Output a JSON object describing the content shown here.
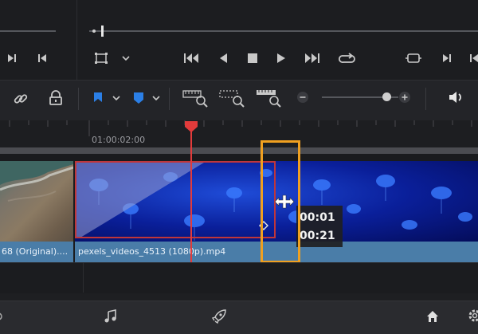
{
  "timeline": {
    "timecode": "01:00:02:00"
  },
  "clips": [
    {
      "label": "68 (Original)...."
    },
    {
      "label": "pexels_videos_4513 (1080p).mp4"
    }
  ],
  "tooltip": {
    "line1": "00:01",
    "line2": "00:21"
  },
  "icons": {
    "transport": [
      "next-frame-icon",
      "prev-frame-icon",
      "crop-icon",
      "chevron-down-icon",
      "skip-to-start-icon",
      "play-reverse-icon",
      "stop-icon",
      "play-icon",
      "skip-to-end-icon",
      "loop-icon",
      "match-frame-icon",
      "next-frame-icon",
      "prev-frame-icon"
    ],
    "toolbar": [
      "link-icon",
      "lock-icon",
      "flag-icon",
      "marker-icon",
      "zoom-full-icon",
      "zoom-detail-icon",
      "zoom-custom-icon",
      "zoom-out-icon",
      "zoom-in-icon",
      "speaker-icon"
    ],
    "bottom_nav": [
      "settings-icon",
      "music-icon",
      "deliver-rocket-icon",
      "home-icon",
      "gear-icon"
    ]
  },
  "colors": {
    "background": "#1e1f22",
    "playhead": "#e23b3b",
    "highlight_box": "#f0a020",
    "flag_blue": "#2b7fe6",
    "clip_label_bg": "#4a7da8",
    "selected_clip_border": "#c0363a"
  }
}
